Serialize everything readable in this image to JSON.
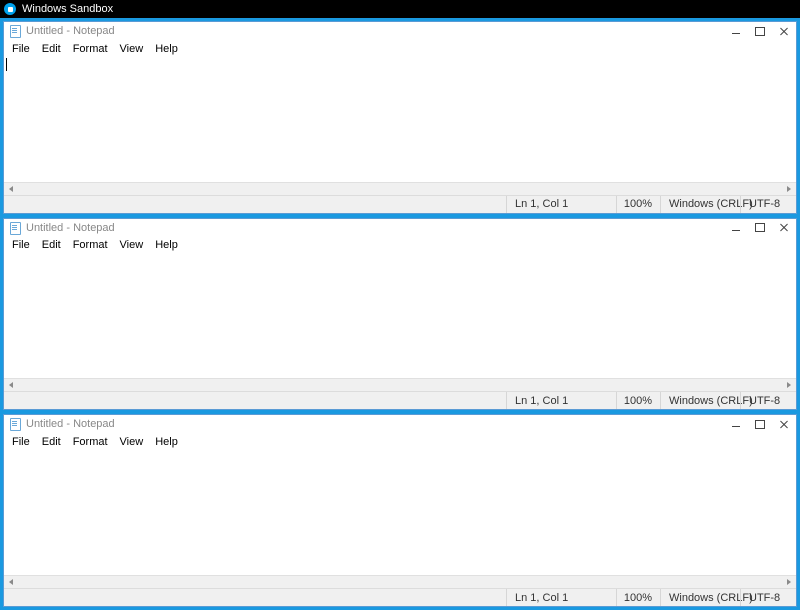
{
  "sandbox": {
    "title": "Windows Sandbox"
  },
  "notepads": [
    {
      "title": "Untitled - Notepad",
      "focused": true,
      "menu": {
        "file": "File",
        "edit": "Edit",
        "format": "Format",
        "view": "View",
        "help": "Help"
      },
      "content": "",
      "status": {
        "lncol": "Ln 1, Col 1",
        "zoom": "100%",
        "eol": "Windows (CRLF)",
        "encoding": "UTF-8"
      }
    },
    {
      "title": "Untitled - Notepad",
      "focused": false,
      "menu": {
        "file": "File",
        "edit": "Edit",
        "format": "Format",
        "view": "View",
        "help": "Help"
      },
      "content": "",
      "status": {
        "lncol": "Ln 1, Col 1",
        "zoom": "100%",
        "eol": "Windows (CRLF)",
        "encoding": "UTF-8"
      }
    },
    {
      "title": "Untitled - Notepad",
      "focused": false,
      "menu": {
        "file": "File",
        "edit": "Edit",
        "format": "Format",
        "view": "View",
        "help": "Help"
      },
      "content": "",
      "status": {
        "lncol": "Ln 1, Col 1",
        "zoom": "100%",
        "eol": "Windows (CRLF)",
        "encoding": "UTF-8"
      }
    }
  ]
}
